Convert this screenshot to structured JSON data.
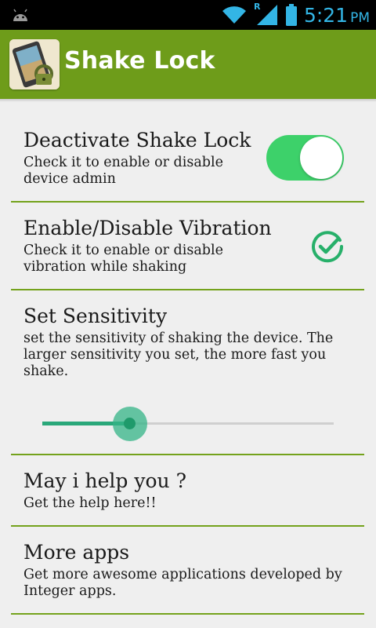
{
  "status_bar": {
    "time": "5:21",
    "ampm": "PM",
    "roaming": "R",
    "accent": "#33b5e5",
    "icons": [
      "android-icon",
      "wifi-icon",
      "signal-icon",
      "battery-icon"
    ]
  },
  "action_bar": {
    "title": "Shake Lock",
    "color": "#6e9c1a"
  },
  "settings": [
    {
      "title": "Deactivate Shake Lock",
      "summary": "Check it to enable or disable device admin",
      "control": "switch",
      "checked": true
    },
    {
      "title": "Enable/Disable Vibration",
      "summary": "Check it to enable or disable vibration while shaking",
      "control": "checkbox",
      "checked": true
    },
    {
      "title": "Set Sensitivity",
      "summary": "set the sensitivity of shaking the device. The larger sensitivity you set, the more fast you shake.",
      "control": "slider",
      "value": 0.3
    },
    {
      "title": "May i help you ?",
      "summary": "Get the help here!!"
    },
    {
      "title": "More apps",
      "summary": "Get more awesome applications developed by Integer apps."
    }
  ],
  "colors": {
    "divider": "#74a21c",
    "switch_on": "#3dd16a",
    "slider": "#2aa87a"
  }
}
